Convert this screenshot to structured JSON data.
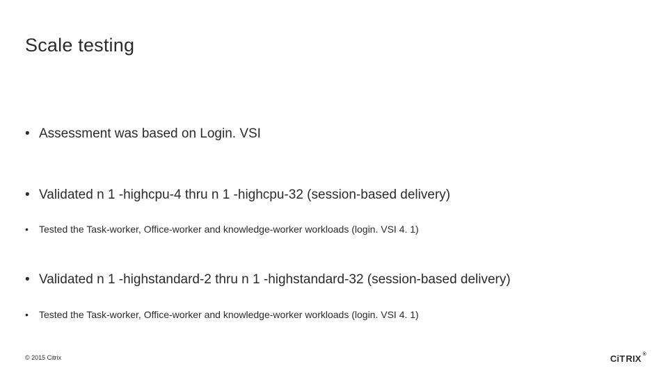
{
  "title": "Scale testing",
  "bullets": {
    "b0": "Assessment was based on Login. VSI",
    "b1": "Validated n 1 -highcpu-4 thru n 1 -highcpu-32 (session-based delivery)",
    "b2": "Tested the Task-worker, Office-worker and knowledge-worker workloads (login. VSI 4. 1)",
    "b3": "Validated n 1 -highstandard-2 thru n 1 -highstandard-32 (session-based delivery)",
    "b4": "Tested the Task-worker, Office-worker and knowledge-worker workloads (login. VSI 4. 1)"
  },
  "footer": {
    "copyright": "© 2015 Citrix",
    "brand": "CITRIX",
    "reg": "®"
  }
}
